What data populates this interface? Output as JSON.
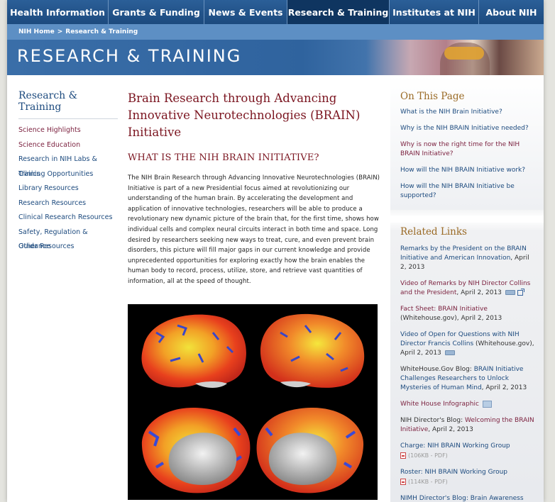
{
  "topnav": {
    "items": [
      {
        "label": "Health Information",
        "active": false
      },
      {
        "label": "Grants & Funding",
        "active": false
      },
      {
        "label": "News & Events",
        "active": false
      },
      {
        "label": "Research & Training",
        "active": true
      },
      {
        "label": "Institutes at NIH",
        "active": false
      },
      {
        "label": "About NIH",
        "active": false
      }
    ]
  },
  "breadcrumb": {
    "home": "NIH Home",
    "separator": ">",
    "current": "Research & Training"
  },
  "banner": {
    "title": "RESEARCH & TRAINING"
  },
  "leftnav": {
    "heading": "Research & Training",
    "items": [
      {
        "label": "Science Highlights",
        "color": "maroon"
      },
      {
        "label": "Science Education",
        "color": "maroon"
      },
      {
        "label": "Research in NIH Labs & Clinics",
        "color": "blue"
      },
      {
        "label": "Training Opportunities",
        "color": "blue"
      },
      {
        "label": "Library Resources",
        "color": "blue"
      },
      {
        "label": "Research Resources",
        "color": "blue"
      },
      {
        "label": "Clinical Research Resources",
        "color": "blue"
      },
      {
        "label": "Safety, Regulation & Guidance",
        "color": "blue"
      },
      {
        "label": "Other Resources",
        "color": "blue"
      }
    ]
  },
  "main": {
    "title": "Brain Research through Advancing Innovative Neurotechnologies (BRAIN) Initiative",
    "section_heading": "WHAT IS THE NIH BRAIN INITIATIVE?",
    "paragraph": "The NIH Brain Research through Advancing Innovative Neurotechnologies (BRAIN) Initiative is part of a new Presidential focus aimed at revolutionizing our understanding of the human brain. By accelerating the development and application of innovative technologies, researchers will be able to produce a revolutionary new dynamic picture of the brain that, for the first time, shows how individual cells and complex neural circuits interact in both time and space. Long desired by researchers seeking new ways to treat, cure, and even prevent brain disorders, this picture will fill major gaps in our current knowledge and provide unprecedented opportunities for exploring exactly how the brain enables the human body to record, process, utilize, store, and retrieve vast quantities of information, all at the speed of thought."
  },
  "on_this_page": {
    "heading": "On This Page",
    "items": [
      {
        "label": "What is the NIH Brain Initiative?",
        "color": "blue"
      },
      {
        "label": "Why is the NIH BRAIN Initiative needed?",
        "color": "blue"
      },
      {
        "label": "Why is now the right time for the NIH BRAIN Initiative?",
        "color": "maroon"
      },
      {
        "label": "How will the NIH BRAIN Initiative work?",
        "color": "blue"
      },
      {
        "label": "How will the NIH BRAIN Initiative be supported?",
        "color": "blue"
      }
    ]
  },
  "related_links": {
    "heading": "Related Links",
    "items": [
      {
        "prefix": "",
        "link": "Remarks by the President on the BRAIN Initiative and American Innovation",
        "suffix": ", April 2, 2013",
        "link_color": "blue",
        "icons": []
      },
      {
        "prefix": "",
        "link": "Video of Remarks by NIH Director Collins and the President",
        "suffix": ", April 2, 2013",
        "link_color": "maroon",
        "icons": [
          "video-icon",
          "external-link-icon"
        ]
      },
      {
        "prefix": "",
        "link": "Fact Sheet: BRAIN Initiative",
        "suffix": " (Whitehouse.gov), April 2, 2013",
        "link_color": "maroon",
        "icons": []
      },
      {
        "prefix": "",
        "link": "Video of Open for Questions with NIH Director Francis Collins",
        "suffix": " (Whitehouse.gov), April 2, 2013",
        "link_color": "blue",
        "icons": [
          "video-icon"
        ]
      },
      {
        "prefix": "WhiteHouse.Gov Blog: ",
        "link": "BRAIN Initiative Challenges Researchers to Unlock Mysteries of Human Mind",
        "suffix": ", April 2, 2013",
        "link_color": "blue",
        "icons": []
      },
      {
        "prefix": "",
        "link": "White House Infographic",
        "suffix": "",
        "link_color": "maroon",
        "icons": [
          "image-icon"
        ]
      },
      {
        "prefix": "NIH Director's Blog: ",
        "link": "Welcoming the BRAIN Initiative",
        "suffix": ", April 2, 2013",
        "link_color": "maroon",
        "icons": []
      },
      {
        "prefix": "",
        "link": "Charge: NIH BRAIN Working Group",
        "suffix": "",
        "link_color": "blue",
        "icons": [],
        "pdf": "(106KB - PDF)"
      },
      {
        "prefix": "",
        "link": "Roster: NIH BRAIN Working Group",
        "suffix": "",
        "link_color": "blue",
        "icons": [],
        "pdf": "(114KB - PDF)"
      },
      {
        "prefix": "",
        "link": "NIMH Director's Blog: Brain Awareness",
        "suffix": "",
        "link_color": "blue",
        "icons": []
      }
    ]
  },
  "colors": {
    "nav_bg": "#1c4a7e",
    "nav_active": "#0f3560",
    "heading_maroon": "#7b1520",
    "link_blue": "#1c4a7e",
    "link_maroon": "#7a1f3d",
    "sidebar_gold": "#9a6a25"
  }
}
